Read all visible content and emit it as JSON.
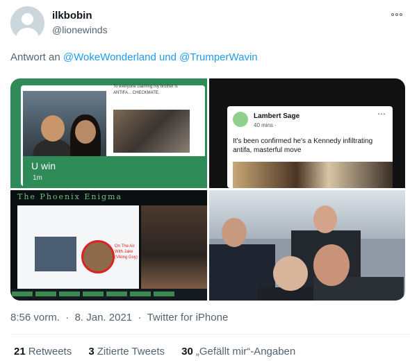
{
  "author": {
    "name": "ilkbobin",
    "handle": "@lionewinds"
  },
  "reply": {
    "prefix": "Antwort an",
    "mentions": "@WokeWonderland und @TrumperWavin"
  },
  "media": {
    "cell1": {
      "caption": "To everyone claiming my brother is ANTIFA... CHECKMATE.",
      "title": "U win",
      "time": "1m"
    },
    "cell2": {
      "name": "Lambert Sage",
      "time": "40 mins ·",
      "text": "It's been confirmed he's a Kennedy infiltrating antifa, masterful move"
    },
    "cell3": {
      "banner": "The Phoenix Enigma",
      "overlay": "On The Air With Jake (Viking Guy)"
    }
  },
  "meta": {
    "time": "8:56 vorm.",
    "date": "8. Jan. 2021",
    "source": "Twitter for iPhone"
  },
  "stats": {
    "retweets_count": "21",
    "retweets_label": "Retweets",
    "quotes_count": "3",
    "quotes_label": "Zitierte Tweets",
    "likes_count": "30",
    "likes_label": "„Gefällt mir“-Angaben"
  },
  "colors": {
    "link": "#1d9bf0",
    "muted": "#536471",
    "text": "#0f1419"
  }
}
